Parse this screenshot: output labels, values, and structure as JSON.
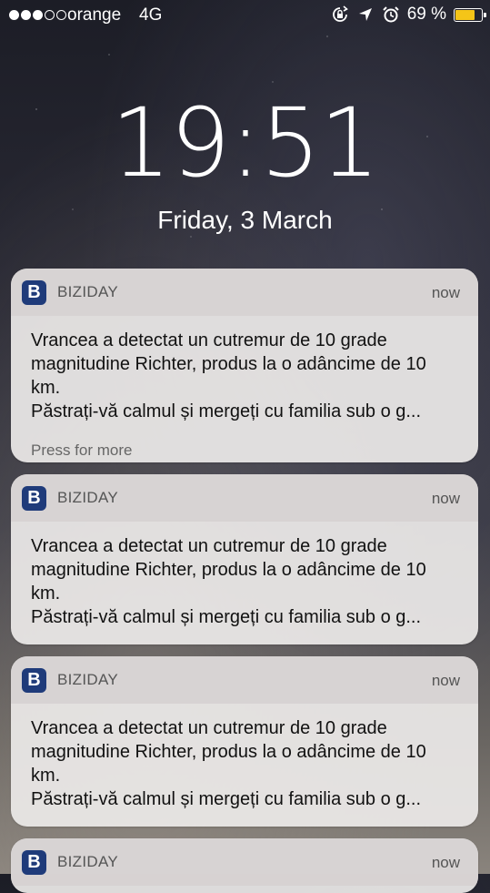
{
  "status_bar": {
    "carrier": "orange",
    "network": "4G",
    "battery_percent": "69 %",
    "battery_level": 0.69,
    "signal_bars_filled": 3,
    "signal_bars_total": 5,
    "icons": [
      "rotation-lock-icon",
      "location-arrow-icon",
      "alarm-clock-icon"
    ],
    "battery_color": "#f5c518"
  },
  "lock_screen": {
    "time": "19:51",
    "date": "Friday, 3 March"
  },
  "notifications": [
    {
      "app_icon_letter": "B",
      "app_name": "BIZIDAY",
      "time": "now",
      "line1": "Vrancea a detectat un cutremur de 10 grade magnitudine Richter, produs la o adâncime de 10 km.",
      "line2": "Păstrați-vă calmul și mergeți cu familia sub o g...",
      "press_for_more": "Press for more"
    },
    {
      "app_icon_letter": "B",
      "app_name": "BIZIDAY",
      "time": "now",
      "line1": "Vrancea a detectat un cutremur de 10 grade magnitudine Richter, produs la o adâncime de 10 km.",
      "line2": "Păstrați-vă calmul și mergeți cu familia sub o g..."
    },
    {
      "app_icon_letter": "B",
      "app_name": "BIZIDAY",
      "time": "now",
      "line1": "Vrancea a detectat un cutremur de 10 grade magnitudine Richter, produs la o adâncime de 10 km.",
      "line2": "Păstrați-vă calmul și mergeți cu familia sub o g..."
    },
    {
      "app_icon_letter": "B",
      "app_name": "BIZIDAY",
      "time": "now"
    }
  ],
  "colors": {
    "app_icon_bg": "#1f3b7a",
    "notification_bg": "#ece9e8"
  }
}
